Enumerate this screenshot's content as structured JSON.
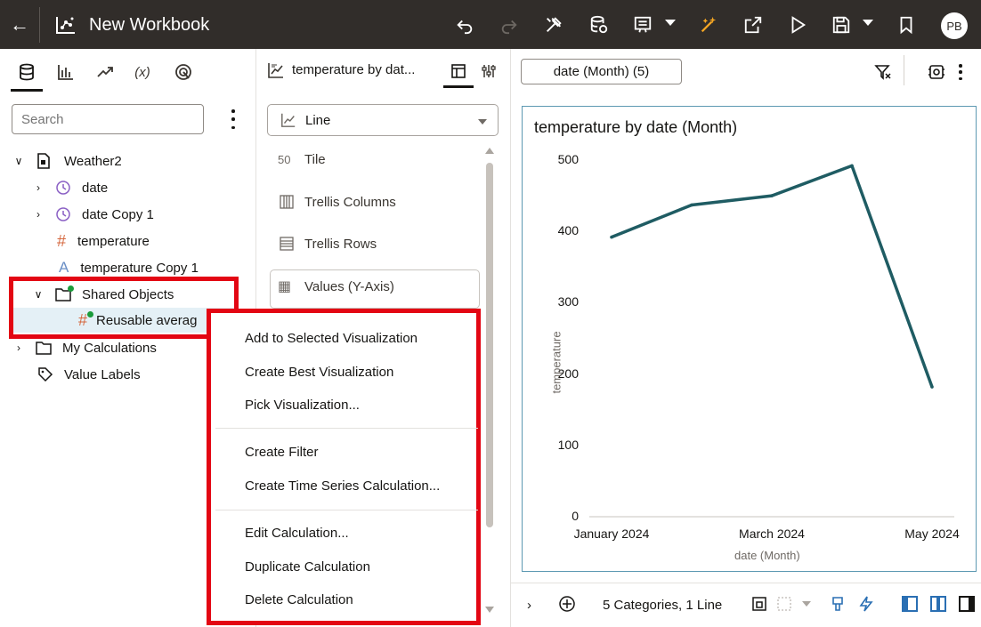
{
  "header": {
    "title": "New Workbook",
    "avatar_initials": "PB",
    "icons": [
      "back-arrow-icon",
      "workbook-icon",
      "undo-icon",
      "redo-icon",
      "tools-icon",
      "data-refresh-icon",
      "present-icon",
      "auto-insights-icon",
      "export-icon",
      "preview-play-icon",
      "save-icon",
      "bookmark-icon"
    ]
  },
  "left_panel": {
    "tabs": [
      "data-icon",
      "visualizations-icon",
      "analytics-icon",
      "calculations-icon",
      "insights-icon"
    ],
    "search_placeholder": "Search",
    "tree": {
      "root": "Weather2",
      "date": "date",
      "date_copy": "date Copy 1",
      "temperature": "temperature",
      "temperature_copy": "temperature Copy 1",
      "shared_objects": "Shared Objects",
      "reusable": "Reusable averag",
      "my_calculations": "My Calculations",
      "value_labels": "Value Labels"
    }
  },
  "middle_panel": {
    "title": "temperature by dat...",
    "viz_type": "Line",
    "drop_targets": {
      "tile": "Tile",
      "tile_icon_text": "50",
      "trellis_columns": "Trellis Columns",
      "trellis_rows": "Trellis Rows",
      "values_y": "Values (Y-Axis)"
    }
  },
  "context_menu": {
    "items": [
      "Add to Selected Visualization",
      "Create Best Visualization",
      "Pick Visualization...",
      "Create Filter",
      "Create Time Series Calculation...",
      "Edit Calculation...",
      "Duplicate Calculation",
      "Delete Calculation"
    ]
  },
  "right_panel": {
    "filter_pill": "date (Month) (5)",
    "status_text": "5 Categories, 1 Line"
  },
  "chart_data": {
    "type": "line",
    "title": "temperature by date (Month)",
    "xlabel": "date (Month)",
    "ylabel": "temperature",
    "x_tick_labels": [
      "January 2024",
      "March 2024",
      "May 2024"
    ],
    "y_ticks": [
      0,
      100,
      200,
      300,
      400,
      500
    ],
    "ylim": [
      0,
      500
    ],
    "series": [
      {
        "points": [
          [
            0,
            392
          ],
          [
            1,
            437
          ],
          [
            2,
            450
          ],
          [
            3,
            492
          ],
          [
            4,
            182
          ]
        ],
        "color": "#1f5c63"
      }
    ],
    "grid": false,
    "legend": "none"
  }
}
